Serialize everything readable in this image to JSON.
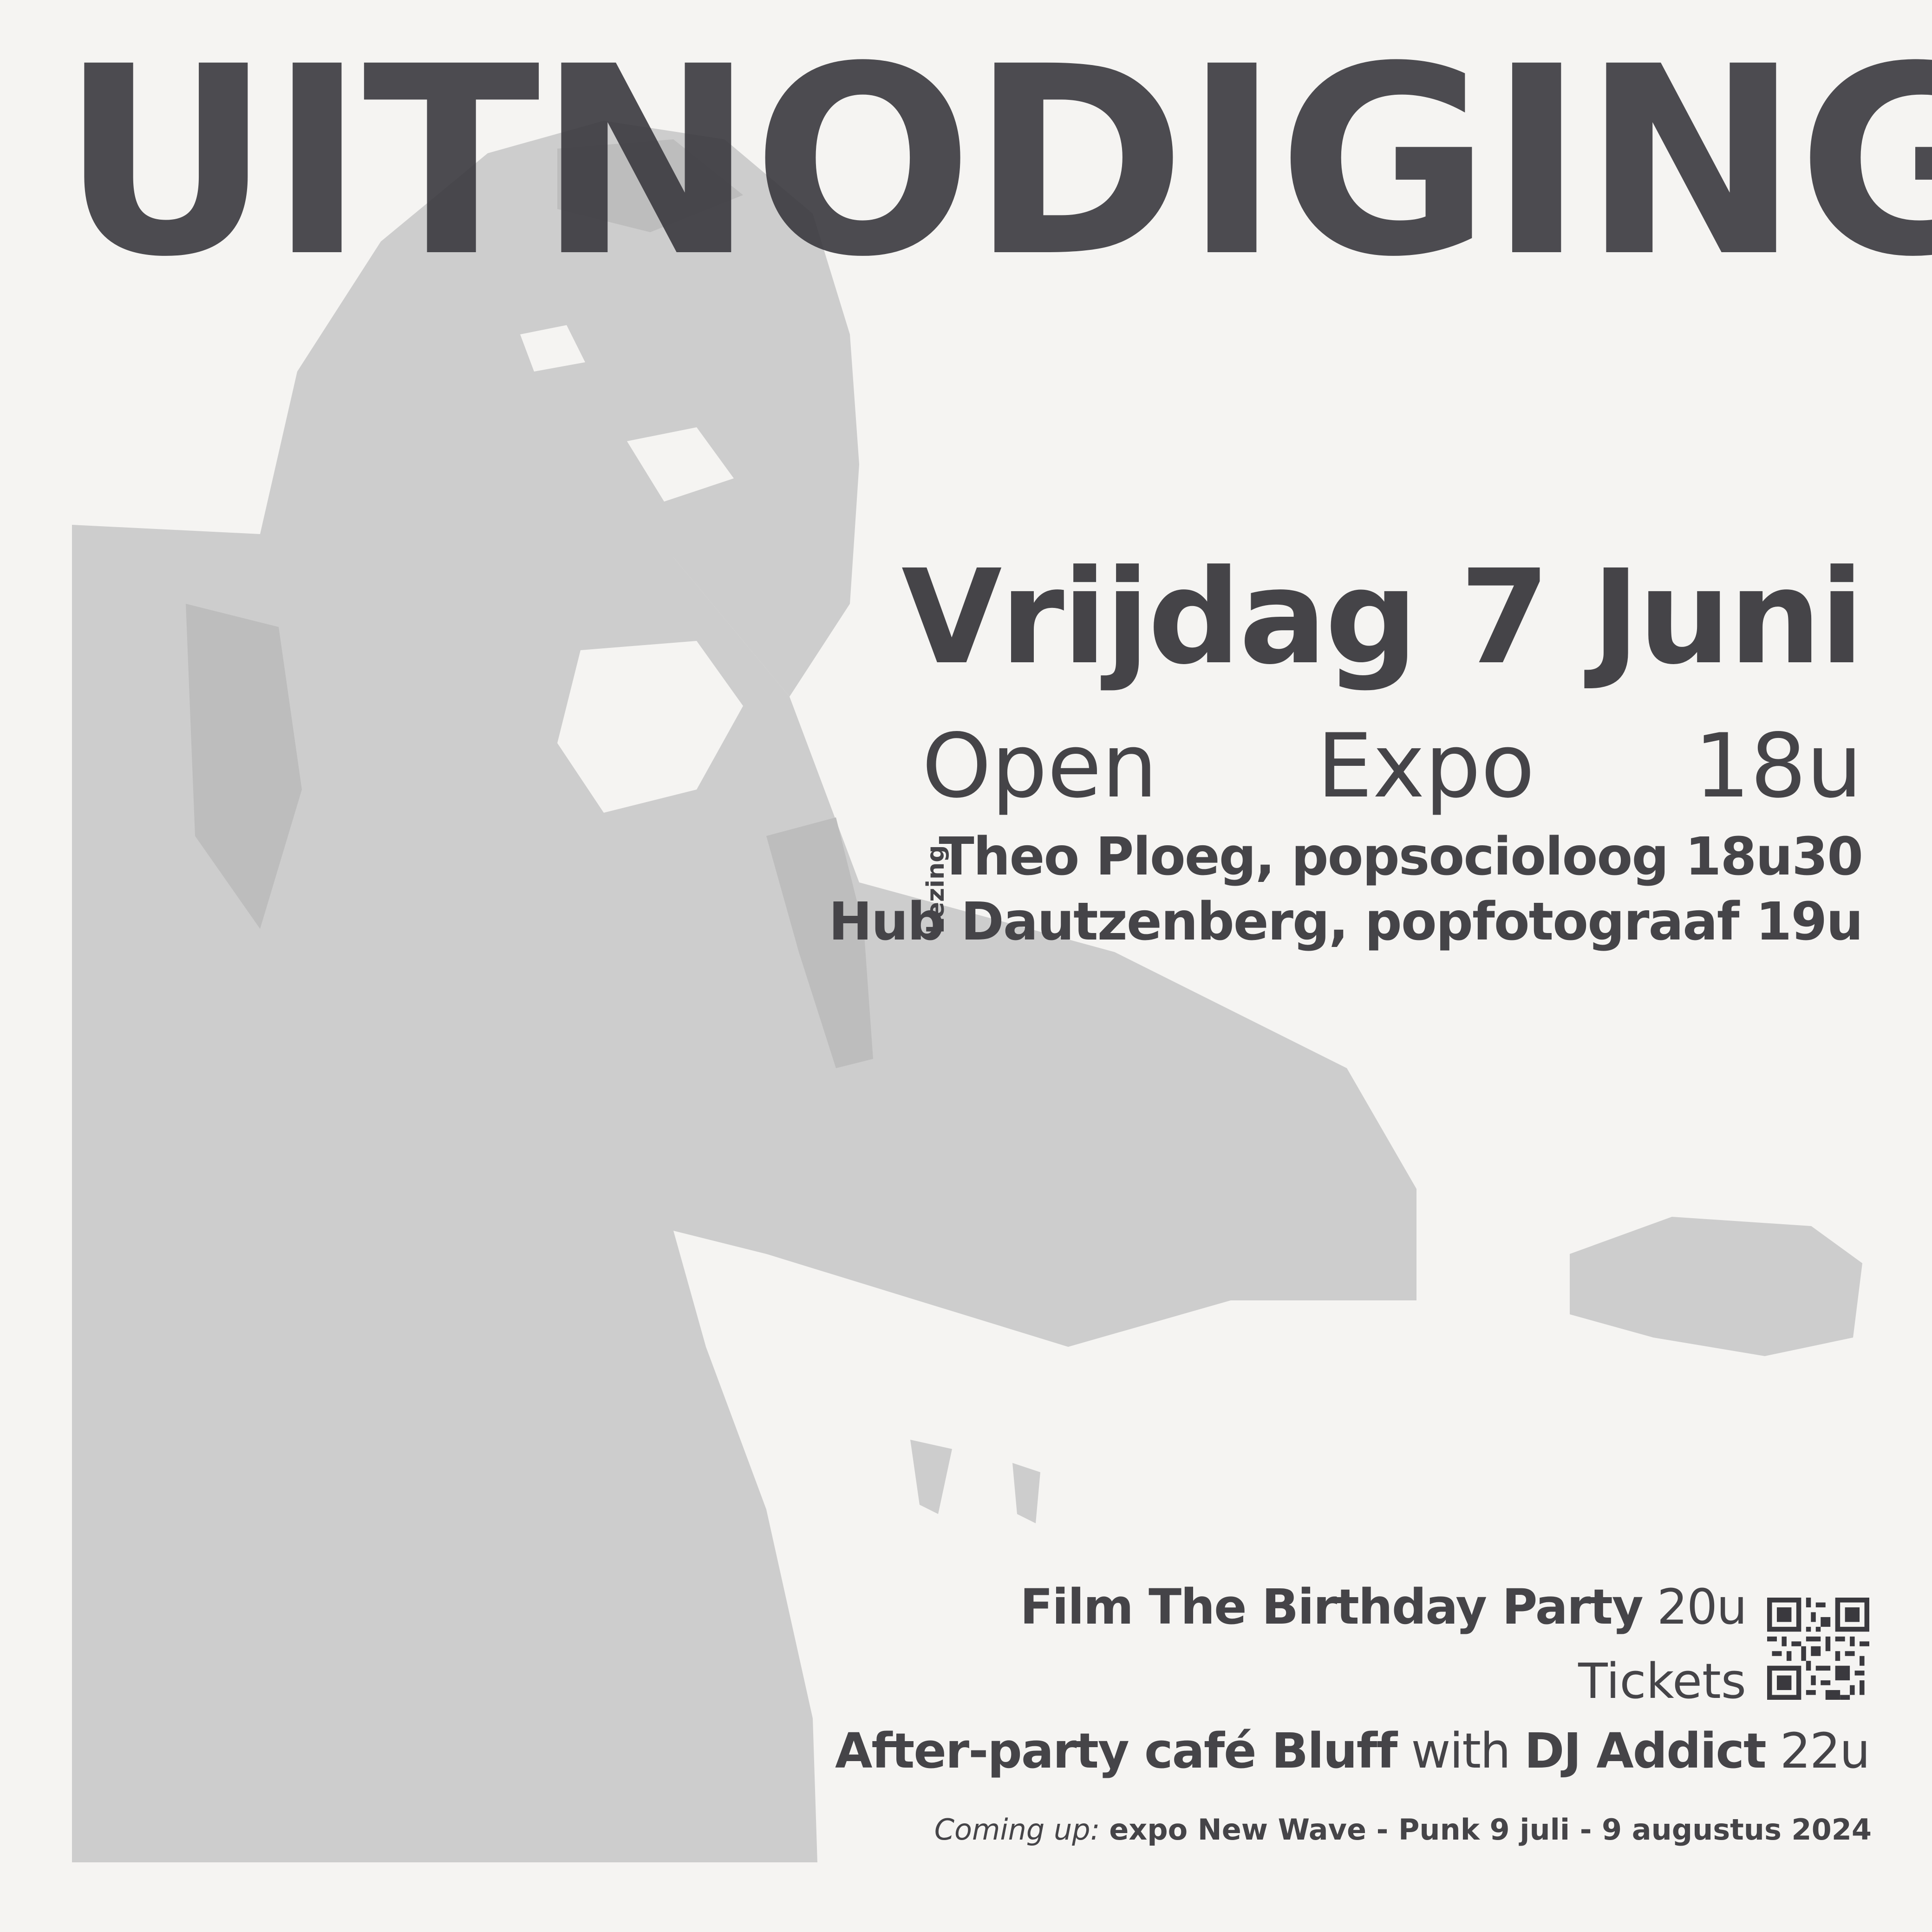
{
  "title": "UITNODIGING",
  "date": "Vrijdag 7 Juni",
  "open_expo": {
    "word1": "Open",
    "word2": "Expo",
    "time": "18u"
  },
  "lezing": {
    "label": "Lezing",
    "items": [
      {
        "text": "Theo Ploeg, popsocioloog 18u30"
      },
      {
        "text": "Hub Dautzenberg, popfotograaf 19u"
      }
    ]
  },
  "film": {
    "label": "Film The Birthday Party",
    "time": "20u",
    "tickets": "Tickets"
  },
  "afterparty": {
    "part1": "After-party café Bluff",
    "part2": "with",
    "part3": "DJ Addict",
    "time": "22u"
  },
  "coming_up": {
    "label": "Coming up:",
    "text": "expo New Wave - Punk 9 juli - 9 augustus 2024"
  },
  "colors": {
    "background": "#f5f4f2",
    "text": "#454448",
    "photo": "#cfcfcf"
  }
}
